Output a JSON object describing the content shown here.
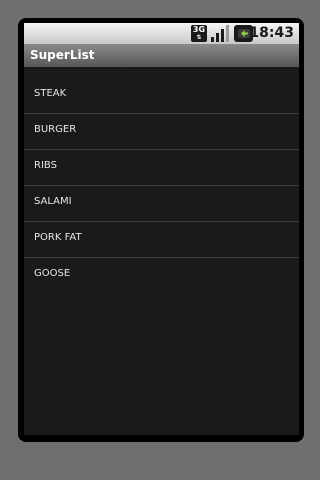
{
  "status_bar": {
    "network": "3G",
    "time": "18:43",
    "icons": [
      "3g-icon",
      "signal-icon",
      "battery-charging-icon"
    ],
    "signal_level": 0.75
  },
  "title_bar": {
    "title": "SuperList"
  },
  "list": {
    "items": [
      {
        "label": "STEAK"
      },
      {
        "label": "BURGER"
      },
      {
        "label": "RIBS"
      },
      {
        "label": "SALAMI"
      },
      {
        "label": "PORK FAT"
      },
      {
        "label": "GOOSE"
      }
    ]
  },
  "colors": {
    "background": "#1a1a1a",
    "text": "#e6e6e6",
    "divider": "#3c3c3c",
    "emulator_surround": "#6f6f6f"
  }
}
